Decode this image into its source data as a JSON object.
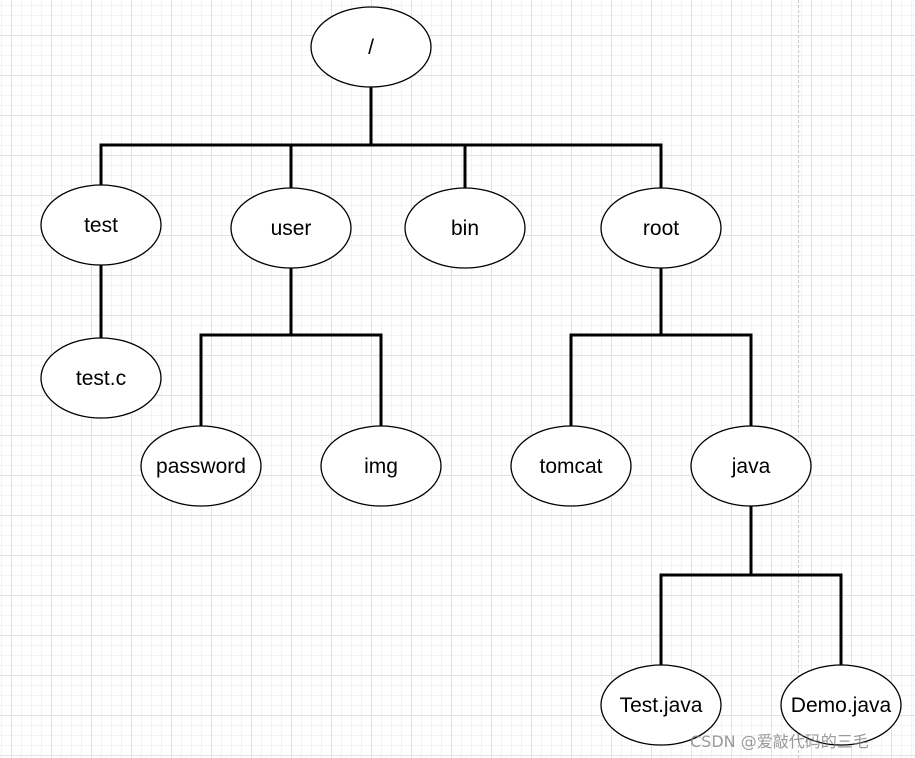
{
  "diagram": {
    "type": "tree",
    "nodes": [
      {
        "id": "root_dir",
        "label": "/",
        "parent": null
      },
      {
        "id": "test",
        "label": "test",
        "parent": "root_dir"
      },
      {
        "id": "user",
        "label": "user",
        "parent": "root_dir"
      },
      {
        "id": "bin",
        "label": "bin",
        "parent": "root_dir"
      },
      {
        "id": "root",
        "label": "root",
        "parent": "root_dir"
      },
      {
        "id": "testc",
        "label": "test.c",
        "parent": "test"
      },
      {
        "id": "password",
        "label": "password",
        "parent": "user"
      },
      {
        "id": "img",
        "label": "img",
        "parent": "user"
      },
      {
        "id": "tomcat",
        "label": "tomcat",
        "parent": "root"
      },
      {
        "id": "java",
        "label": "java",
        "parent": "root"
      },
      {
        "id": "testjava",
        "label": "Test.java",
        "parent": "java"
      },
      {
        "id": "demojava",
        "label": "Demo.java",
        "parent": "java"
      }
    ],
    "colors": {
      "stroke": "#000000",
      "fill": "#ffffff",
      "grid": "#e2e2e2"
    }
  },
  "watermark": "CSDN @爱敲代码的三毛"
}
